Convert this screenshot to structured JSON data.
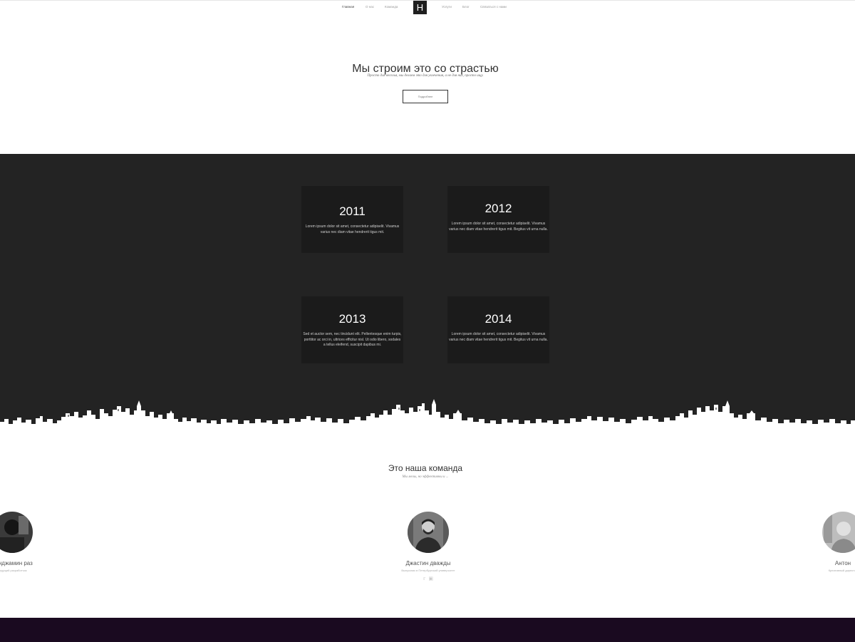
{
  "nav": {
    "items_left": [
      "Главная",
      "О нас",
      "Команда"
    ],
    "logo": "H",
    "items_right": [
      "Услуги",
      "Блог",
      "Связаться с нами"
    ]
  },
  "hero": {
    "title": "Мы строим это со страстью",
    "subtitle": "Просто для веселья, мы делаем это для увлечения, а не для них, просто ищу.",
    "button": "Подробнее"
  },
  "timeline": [
    {
      "year": "2011",
      "text": "Lorem ipsum dolor sit amet, consectetur adipiselit. Vivamus varius nec diam vitae hendrerit tigus mit."
    },
    {
      "year": "2012",
      "text": "Lorem ipsum dolor sit amet, consectetur adipiselit. Vivamus varius nec diam vitae hendrerit tigus mit. Begitus vit urna nulla."
    },
    {
      "year": "2013",
      "text": "Sed et auctor sem, nec tincidunt elit. Pellentesque enim turpis, porttitor ac orci in, ultrices efficitur nisl. Ut odio libero, sodales a tellus eleifend, suscipit dapibus mi."
    },
    {
      "year": "2014",
      "text": "Lorem ipsum dolor sit amet, consectetur adipiselit. Vivamus varius nec diam vitae hendrerit tigus mit. Begitus vit urna nulla."
    }
  ],
  "team": {
    "title": "Это наша команда",
    "subtitle": "Мы мелы, но эффективны и ...",
    "members": [
      {
        "name": "Бенджамин раз",
        "role": "Ведущий разработчик"
      },
      {
        "name": "Джастин дважды",
        "role": "Выпускник в Петербургский университет"
      },
      {
        "name": "Антон",
        "role": "Креативный директор"
      }
    ],
    "social_icons": [
      "twitter-icon",
      "instagram-icon"
    ]
  },
  "colors": {
    "timeline_bg": "#232323",
    "card_bg": "#1b1b1b",
    "footer_bg": "#1a0a20"
  }
}
